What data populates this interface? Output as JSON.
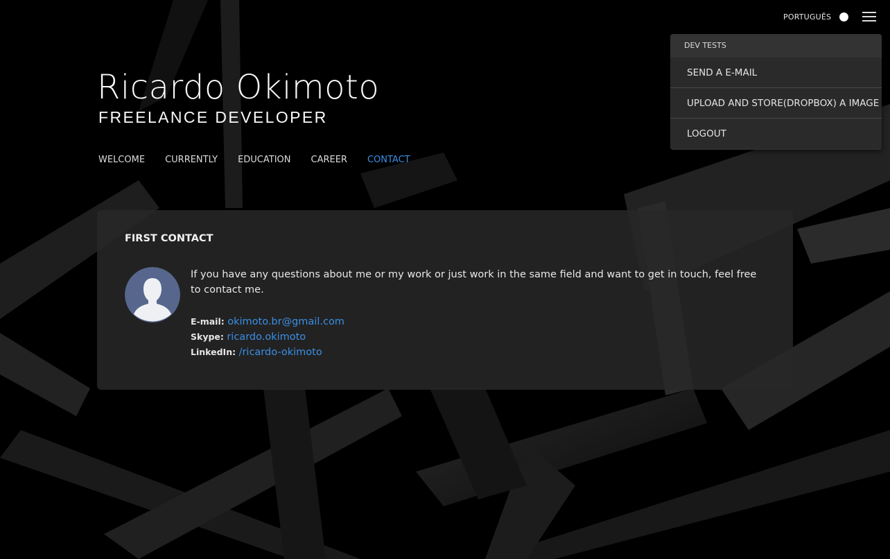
{
  "topbar": {
    "language_label": "PORTUGUÊS",
    "theme_toggle_icon": "circle-toggle-icon",
    "menu_icon": "hamburger-menu-icon"
  },
  "dropdown": {
    "header": "DEV TESTS",
    "items": [
      {
        "label": "SEND A E-MAIL"
      },
      {
        "label": "UPLOAD AND STORE(DROPBOX) A IMAGE"
      },
      {
        "label": "LOGOUT"
      }
    ]
  },
  "header": {
    "name": "Ricardo Okimoto",
    "subtitle": "FREELANCE DEVELOPER"
  },
  "nav": {
    "items": [
      {
        "label": "WELCOME"
      },
      {
        "label": "CURRENTLY"
      },
      {
        "label": "EDUCATION"
      },
      {
        "label": "CAREER"
      },
      {
        "label": "CONTACT"
      }
    ],
    "active": "CONTACT"
  },
  "card": {
    "title": "FIRST CONTACT",
    "avatar_icon": "user-avatar-icon",
    "intro": "If you have any questions about me or my work or just work in the same field and want to get in touch, feel free to contact me.",
    "contacts": [
      {
        "label": "E-mail:",
        "value": "okimoto.br@gmail.com"
      },
      {
        "label": "Skype:",
        "value": "ricardo.okimoto"
      },
      {
        "label": "LinkedIn:",
        "value": "/ricardo-okimoto"
      }
    ]
  },
  "colors": {
    "background": "#000000",
    "accent": "#3a8fe6",
    "card": "#282828",
    "dropdown": "#2e2e2e",
    "avatar_bg": "#56668c"
  }
}
